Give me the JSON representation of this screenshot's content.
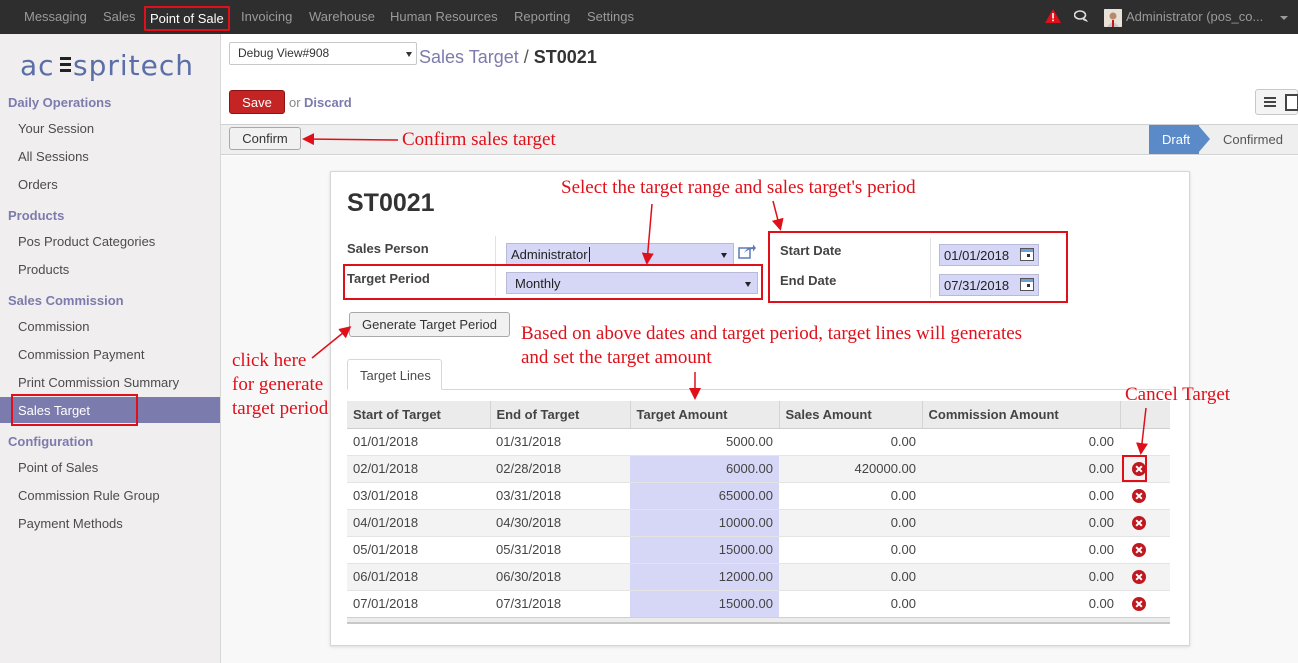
{
  "topbar": {
    "menu": [
      "Messaging",
      "Sales",
      "Point of Sale",
      "Invoicing",
      "Warehouse",
      "Human Resources",
      "Reporting",
      "Settings"
    ],
    "user": "Administrator (pos_co..."
  },
  "sidebar": {
    "logo": "acespritech",
    "sections": [
      {
        "title": "Daily Operations",
        "items": [
          "Your Session",
          "All Sessions",
          "Orders"
        ]
      },
      {
        "title": "Products",
        "items": [
          "Pos Product Categories",
          "Products"
        ]
      },
      {
        "title": "Sales Commission",
        "items": [
          "Commission",
          "Commission Payment",
          "Print Commission Summary",
          "Sales Target"
        ]
      },
      {
        "title": "Configuration",
        "items": [
          "Point of Sales",
          "Commission Rule Group",
          "Payment Methods"
        ]
      }
    ],
    "active_item": "Sales Target"
  },
  "header": {
    "debug_select": "Debug View#908",
    "breadcrumb_parent": "Sales Target",
    "breadcrumb_sep": "/",
    "breadcrumb_current": "ST0021",
    "save_label": "Save",
    "or_text": "or",
    "discard_label": "Discard"
  },
  "statusbar": {
    "confirm_label": "Confirm",
    "stages": [
      "Draft",
      "Confirmed"
    ],
    "current_stage": "Draft"
  },
  "form": {
    "title": "ST0021",
    "sales_person_label": "Sales Person",
    "sales_person_value": "Administrator",
    "target_period_label": "Target Period",
    "target_period_value": "Monthly",
    "start_date_label": "Start Date",
    "start_date_value": "01/01/2018",
    "end_date_label": "End Date",
    "end_date_value": "07/31/2018",
    "generate_button": "Generate Target Period",
    "tab_label": "Target Lines"
  },
  "target_lines": {
    "columns": [
      "Start of Target",
      "End of Target",
      "Target Amount",
      "Sales Amount",
      "Commission Amount"
    ],
    "rows": [
      {
        "start": "01/01/2018",
        "end": "01/31/2018",
        "target": "5000.00",
        "sales": "0.00",
        "commission": "0.00"
      },
      {
        "start": "02/01/2018",
        "end": "02/28/2018",
        "target": "6000.00",
        "sales": "420000.00",
        "commission": "0.00"
      },
      {
        "start": "03/01/2018",
        "end": "03/31/2018",
        "target": "65000.00",
        "sales": "0.00",
        "commission": "0.00"
      },
      {
        "start": "04/01/2018",
        "end": "04/30/2018",
        "target": "10000.00",
        "sales": "0.00",
        "commission": "0.00"
      },
      {
        "start": "05/01/2018",
        "end": "05/31/2018",
        "target": "15000.00",
        "sales": "0.00",
        "commission": "0.00"
      },
      {
        "start": "06/01/2018",
        "end": "06/30/2018",
        "target": "12000.00",
        "sales": "0.00",
        "commission": "0.00"
      },
      {
        "start": "07/01/2018",
        "end": "07/31/2018",
        "target": "15000.00",
        "sales": "0.00",
        "commission": "0.00"
      }
    ]
  },
  "annotations": {
    "confirm": "Confirm sales target",
    "select_range": "Select the target range and sales target's period",
    "click_here": [
      "click here",
      "for generate",
      "target period"
    ],
    "based_on": [
      "Based on above dates and target period, target lines will generates",
      "and set the target amount"
    ],
    "cancel_target": "Cancel Target"
  },
  "colors": {
    "topbar": "#2e2e2e",
    "accent": "#7c7bad",
    "save": "#c42424",
    "annotation_red": "#e0101a",
    "editable_field": "#d6d6f6",
    "stage_active": "#5b8ac8"
  },
  "icons": [
    "alert-icon",
    "chat-icon",
    "external-link-icon",
    "calendar-icon",
    "delete-icon",
    "list-view-icon",
    "form-view-icon"
  ]
}
